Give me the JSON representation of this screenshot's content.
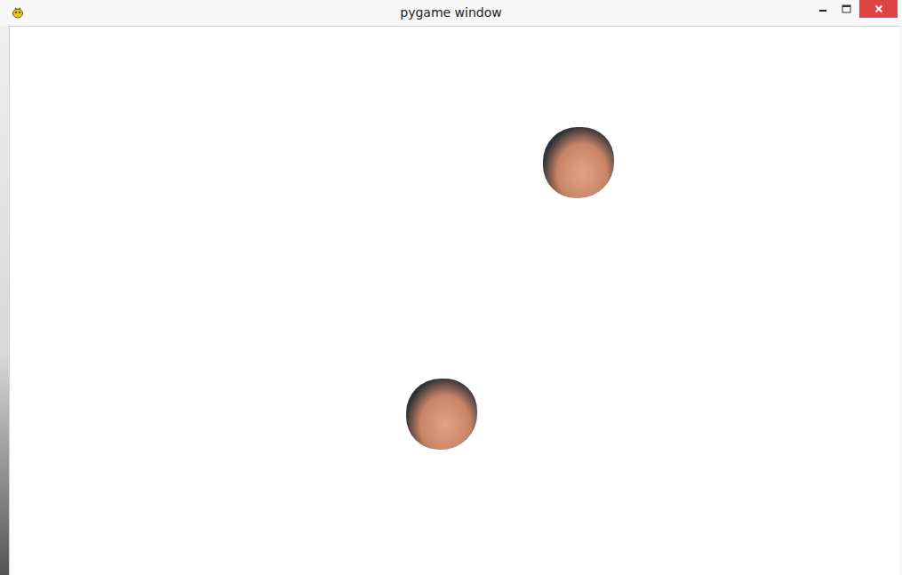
{
  "window": {
    "title": "pygame window"
  },
  "sprites": [
    {},
    {}
  ]
}
